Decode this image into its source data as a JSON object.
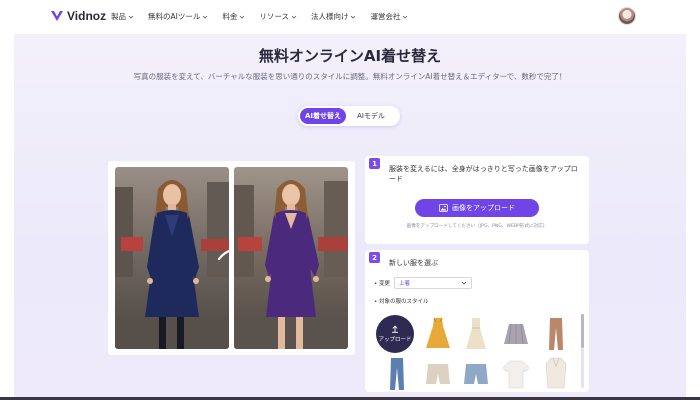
{
  "nav": {
    "logo_text": "Vidnoz",
    "menu": [
      {
        "label": "製品"
      },
      {
        "label": "無料のAIツール"
      },
      {
        "label": "料金"
      },
      {
        "label": "リソース"
      },
      {
        "label": "法人様向け"
      },
      {
        "label": "運営会社"
      }
    ]
  },
  "hero": {
    "title": "無料オンラインAI着せ替え",
    "subtitle": "写真の服装を変えて、バーチャルな服装を思い通りのスタイルに調整。無料オンラインAI着せ替え＆エディターで、数秒で完了！"
  },
  "tabs": [
    {
      "label": "AI着せ替え",
      "active": true
    },
    {
      "label": "AIモデル",
      "active": false
    }
  ],
  "step1": {
    "number": "1",
    "text": "服装を変えるには、全身がはっきりと写った画像をアップロード",
    "button_label": "画像をアップロード",
    "hint": "画像をアップロードしてください（JPG、PNG、WEBP形式に対応）"
  },
  "step2": {
    "number": "2",
    "title": "新しい服を選ぶ",
    "change_label": "変更",
    "change_value": "上着",
    "style_label": "対象の服のスタイル",
    "upload_label": "アップロード"
  },
  "colors": {
    "accent": "#6f45e8",
    "dress_before": "#1f2a5c",
    "dress_after": "#4b2a7e"
  },
  "icons": {
    "logo": "vidnoz-logo-icon",
    "chevron": "chevron-down-icon",
    "image": "image-icon",
    "upload": "upload-arrow-icon",
    "swap": "swap-arrow-icon"
  }
}
